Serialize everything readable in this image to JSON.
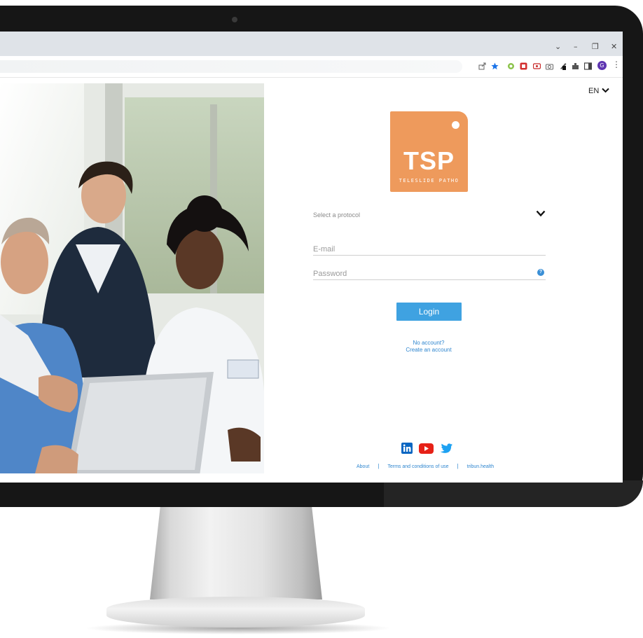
{
  "browser": {
    "window_controls": {
      "dropdown": "⌄",
      "minimize": "–",
      "restore": "❐",
      "close": "✕"
    },
    "profile_initial": "G",
    "menu": "⋮"
  },
  "page": {
    "language": "EN",
    "logo": {
      "main": "TSP",
      "sub": "TELESLIDE PATHO",
      "color": "#ee9a5c"
    },
    "protocol_select": {
      "placeholder": "Select a protocol"
    },
    "email": {
      "placeholder": "E-mail",
      "value": ""
    },
    "password": {
      "placeholder": "Password",
      "value": ""
    },
    "help_symbol": "?",
    "login_label": "Login",
    "signup": {
      "question": "No account?",
      "link": "Create an account"
    },
    "social": [
      "linkedin-icon",
      "youtube-icon",
      "twitter-icon"
    ],
    "footer": {
      "about": "About",
      "terms": "Terms and conditions of use",
      "site": "tribun.health"
    }
  },
  "colors": {
    "accent": "#3fa2e1",
    "link": "#2f86cf",
    "brand": "#ee9a5c"
  }
}
